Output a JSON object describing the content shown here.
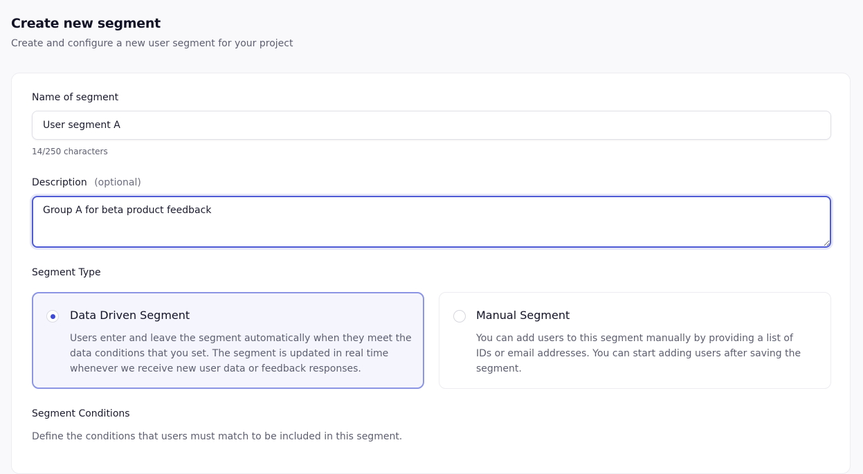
{
  "page": {
    "title": "Create new segment",
    "subtitle": "Create and configure a new user segment for your project"
  },
  "form": {
    "name": {
      "label": "Name of segment",
      "value": "User segment A",
      "char_count": "14/250 characters"
    },
    "description": {
      "label": "Description",
      "optional": "(optional)",
      "value": "Group A for beta product feedback"
    },
    "segment_type": {
      "label": "Segment Type",
      "options": [
        {
          "title": "Data Driven Segment",
          "description": "Users enter and leave the segment automatically when they meet the data conditions that you set. The segment is updated in real time whenever we receive new user data or feedback responses.",
          "selected": true
        },
        {
          "title": "Manual Segment",
          "description": "You can add users to this segment manually by providing a list of IDs or email addresses. You can start adding users after saving the segment.",
          "selected": false
        }
      ]
    },
    "conditions": {
      "label": "Segment Conditions",
      "description": "Define the conditions that users must match to be included in this segment."
    }
  },
  "colors": {
    "accent": "#3f4bd3",
    "selected_border": "#8c95e4",
    "selected_bg": "#f5f6fd",
    "focus_border": "#4f5bd5"
  }
}
